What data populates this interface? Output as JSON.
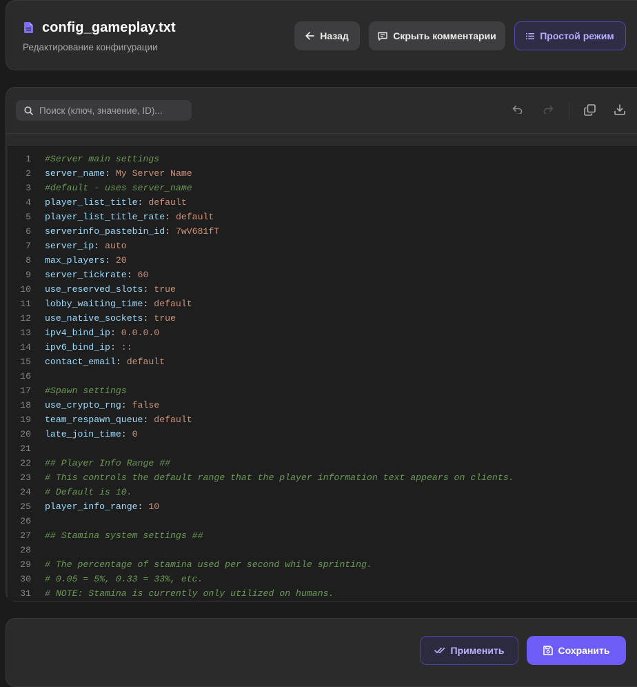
{
  "header": {
    "title": "config_gameplay.txt",
    "subtitle": "Редактирование конфигурации",
    "back_label": "Назад",
    "hide_comments_label": "Скрыть комментарии",
    "simple_mode_label": "Простой режим"
  },
  "toolbar": {
    "search_placeholder": "Поиск (ключ, значение, ID)..."
  },
  "editor": {
    "lines": [
      {
        "n": "1",
        "type": "comment",
        "text": "#Server main settings"
      },
      {
        "n": "2",
        "type": "kv",
        "key": "server_name",
        "value": "My Server Name",
        "vtype": "str"
      },
      {
        "n": "3",
        "type": "comment",
        "text": "#default - uses server_name"
      },
      {
        "n": "4",
        "type": "kv",
        "key": "player_list_title",
        "value": "default",
        "vtype": "str"
      },
      {
        "n": "5",
        "type": "kv",
        "key": "player_list_title_rate",
        "value": "default",
        "vtype": "str"
      },
      {
        "n": "6",
        "type": "kv",
        "key": "serverinfo_pastebin_id",
        "value": "7wV681fT",
        "vtype": "str"
      },
      {
        "n": "7",
        "type": "kv",
        "key": "server_ip",
        "value": "auto",
        "vtype": "str"
      },
      {
        "n": "8",
        "type": "kv",
        "key": "max_players",
        "value": "20",
        "vtype": "str"
      },
      {
        "n": "9",
        "type": "kv",
        "key": "server_tickrate",
        "value": "60",
        "vtype": "str"
      },
      {
        "n": "10",
        "type": "kv",
        "key": "use_reserved_slots",
        "value": "true",
        "vtype": "str"
      },
      {
        "n": "11",
        "type": "kv",
        "key": "lobby_waiting_time",
        "value": "default",
        "vtype": "str"
      },
      {
        "n": "12",
        "type": "kv",
        "key": "use_native_sockets",
        "value": "true",
        "vtype": "str"
      },
      {
        "n": "13",
        "type": "kv",
        "key": "ipv4_bind_ip",
        "value": "0.0.0.0",
        "vtype": "str"
      },
      {
        "n": "14",
        "type": "kv",
        "key": "ipv6_bind_ip",
        "value": "::",
        "vtype": "str"
      },
      {
        "n": "15",
        "type": "kv",
        "key": "contact_email",
        "value": "default",
        "vtype": "str"
      },
      {
        "n": "16",
        "type": "empty"
      },
      {
        "n": "17",
        "type": "comment",
        "text": "#Spawn settings"
      },
      {
        "n": "18",
        "type": "kv",
        "key": "use_crypto_rng",
        "value": "false",
        "vtype": "str"
      },
      {
        "n": "19",
        "type": "kv",
        "key": "team_respawn_queue",
        "value": "default",
        "vtype": "str"
      },
      {
        "n": "20",
        "type": "kv",
        "key": "late_join_time",
        "value": "0",
        "vtype": "str"
      },
      {
        "n": "21",
        "type": "empty"
      },
      {
        "n": "22",
        "type": "comment",
        "text": "## Player Info Range ##"
      },
      {
        "n": "23",
        "type": "comment",
        "text": "# This controls the default range that the player information text appears on clients."
      },
      {
        "n": "24",
        "type": "comment",
        "text": "# Default is 10."
      },
      {
        "n": "25",
        "type": "kv",
        "key": "player_info_range",
        "value": "10",
        "vtype": "str"
      },
      {
        "n": "26",
        "type": "empty"
      },
      {
        "n": "27",
        "type": "comment",
        "text": "## Stamina system settings ##"
      },
      {
        "n": "28",
        "type": "empty"
      },
      {
        "n": "29",
        "type": "comment",
        "text": "# The percentage of stamina used per second while sprinting."
      },
      {
        "n": "30",
        "type": "comment",
        "text": "# 0.05 = 5%, 0.33 = 33%, etc."
      },
      {
        "n": "31",
        "type": "comment",
        "text": "# NOTE: Stamina is currently only utilized on humans."
      }
    ]
  },
  "footer": {
    "apply_label": "Применить",
    "save_label": "Сохранить"
  },
  "colors": {
    "accent": "#6e5cf6",
    "key": "#9cdcfe",
    "value": "#ce9178",
    "comment": "#6a9955"
  }
}
